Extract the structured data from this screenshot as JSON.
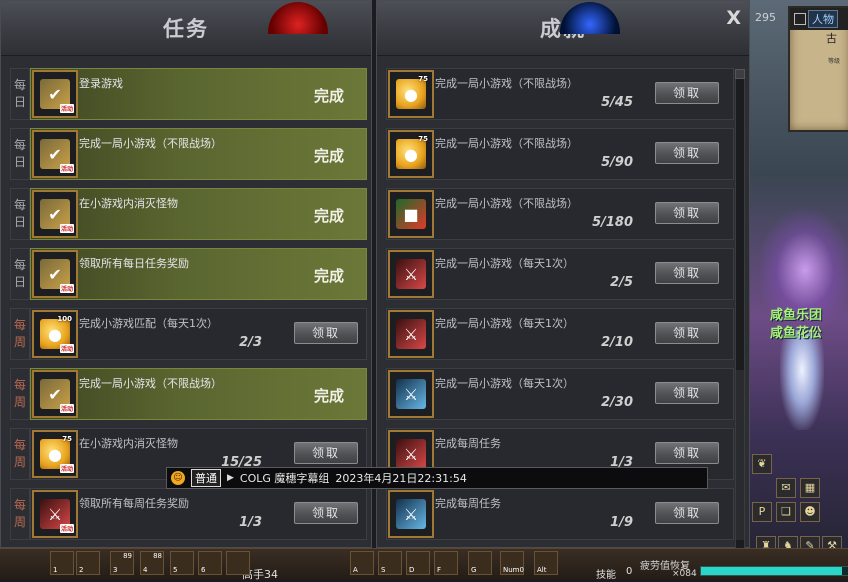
{
  "quest_panel": {
    "title": "任务",
    "rows": [
      {
        "period": [
          "每",
          "日"
        ],
        "period_type": "daily",
        "icon": "check-icon",
        "icon_tag": "活动",
        "text": "登录游戏",
        "status": "完成",
        "progress": null,
        "button": null
      },
      {
        "period": [
          "每",
          "日"
        ],
        "period_type": "daily",
        "icon": "check-icon",
        "icon_tag": "活动",
        "text": "完成一局小游戏（不限战场）",
        "status": "完成",
        "progress": null,
        "button": null
      },
      {
        "period": [
          "每",
          "日"
        ],
        "period_type": "daily",
        "icon": "check-icon",
        "icon_tag": "活动",
        "text": "在小游戏内消灭怪物",
        "status": "完成",
        "progress": null,
        "button": null
      },
      {
        "period": [
          "每",
          "日"
        ],
        "period_type": "daily",
        "icon": "check-icon",
        "icon_tag": "活动",
        "text": "领取所有每日任务奖励",
        "status": "完成",
        "progress": null,
        "button": null
      },
      {
        "period": [
          "每",
          "周"
        ],
        "period_type": "weekly",
        "icon": "coin-icon",
        "icon_tag": "活动",
        "icon_num": "100",
        "text": "完成小游戏匹配（每天1次）",
        "status": null,
        "progress": "2/3",
        "button": "领取"
      },
      {
        "period": [
          "每",
          "周"
        ],
        "period_type": "weekly",
        "icon": "check-icon",
        "icon_tag": "活动",
        "text": "完成一局小游戏（不限战场）",
        "status": "完成",
        "progress": null,
        "button": null
      },
      {
        "period": [
          "每",
          "周"
        ],
        "period_type": "weekly",
        "icon": "coin-icon",
        "icon_tag": "活动",
        "icon_num": "75",
        "text": "在小游戏内消灭怪物",
        "status": null,
        "progress": "15/25",
        "button": "领取"
      },
      {
        "period": [
          "每",
          "周"
        ],
        "period_type": "weekly",
        "icon": "sword-icon",
        "icon_tag": "活动",
        "text": "领取所有每周任务奖励",
        "status": null,
        "progress": "1/3",
        "button": "领取"
      }
    ]
  },
  "achievement_panel": {
    "title": "成就",
    "close_label": "X",
    "rows": [
      {
        "icon": "coin-icon",
        "icon_num": "75",
        "text": "完成一局小游戏（不限战场）",
        "progress": "5/45",
        "button": "领取"
      },
      {
        "icon": "coin-icon",
        "icon_num": "75",
        "text": "完成一局小游戏（不限战场）",
        "progress": "5/90",
        "button": "领取"
      },
      {
        "icon": "gift-icon",
        "icon_num": "",
        "text": "完成一局小游戏（不限战场）",
        "progress": "5/180",
        "button": "领取"
      },
      {
        "icon": "sword-icon",
        "icon_num": "",
        "text": "完成一局小游戏（每天1次）",
        "progress": "2/5",
        "button": "领取"
      },
      {
        "icon": "sword-icon",
        "icon_num": "",
        "text": "完成一局小游戏（每天1次）",
        "progress": "2/10",
        "button": "领取"
      },
      {
        "icon": "sword-blue-icon",
        "icon_num": "",
        "text": "完成一局小游戏（每天1次）",
        "progress": "2/30",
        "button": "领取"
      },
      {
        "icon": "sword-icon",
        "icon_num": "",
        "text": "完成每周任务",
        "progress": "1/3",
        "button": "领取"
      },
      {
        "icon": "sword-blue-icon",
        "icon_num": "",
        "text": "完成每周任务",
        "progress": "1/9",
        "button": "领取"
      }
    ]
  },
  "chat": {
    "channel": "普通",
    "message": "COLG 魔穗字幕组",
    "timestamp": "2023年4月21日22:31:54"
  },
  "minimap": {
    "tab": "人物",
    "place": "古",
    "sub": "等级",
    "clock": "295"
  },
  "guild": {
    "line1": "咸鱼乐团",
    "line2": "咸鱼花伀"
  },
  "hud": {
    "level": "高手34",
    "skill_label": "技能",
    "skill_points": "0",
    "buff_label": "疲劳值恢复",
    "gold": "×084",
    "slots": [
      {
        "key": "1",
        "cnt": ""
      },
      {
        "key": "2",
        "cnt": ""
      },
      {
        "key": "3",
        "cnt": "89"
      },
      {
        "key": "4",
        "cnt": "88"
      },
      {
        "key": "5",
        "cnt": ""
      },
      {
        "key": "6",
        "cnt": ""
      },
      {
        "key": "",
        "cnt": ""
      },
      {
        "key": "A",
        "cnt": ""
      },
      {
        "key": "S",
        "cnt": ""
      },
      {
        "key": "D",
        "cnt": ""
      },
      {
        "key": "F",
        "cnt": ""
      },
      {
        "key": "G",
        "cnt": ""
      },
      {
        "key": "Num0",
        "cnt": ""
      },
      {
        "key": "Alt",
        "cnt": ""
      }
    ],
    "exp_fraction": 0.95
  },
  "colors": {
    "complete_row": "#5a6630",
    "panel_bg": "#2c2e34",
    "icon_border": "#a07a34",
    "weekly_text": "#b86a52"
  }
}
